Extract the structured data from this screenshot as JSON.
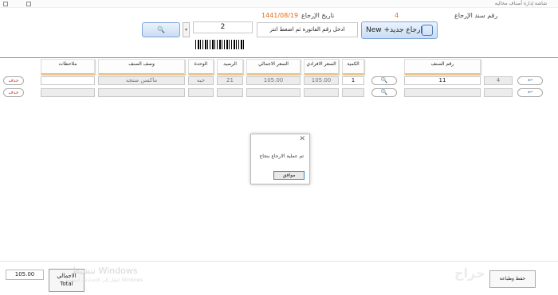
{
  "window": {
    "title": "شاشة إدارة أصناف مخالية"
  },
  "header": {
    "return_no_label": "رقم سند الإرجاع",
    "return_no_value": "4",
    "date_label": "تاريخ الإرجاع",
    "date_value": "1441/08/19"
  },
  "toolbar": {
    "new_button_label": "New +إرجاع جديد",
    "invoice_placeholder": "ادخل رقم الفاتورة ثم اضغط انتر",
    "invoice_number": "2",
    "search_icon": "magnifier-icon"
  },
  "table": {
    "columns": [
      "رقم الصنف",
      "الكمية",
      "السعر الافرادي",
      "السعر الاجمالي",
      "الرصيد",
      "الوحدة",
      "وصف الصنف",
      "ملاحظات"
    ],
    "rows": [
      {
        "index": "4",
        "item_no": "11",
        "qty": "1",
        "unit_price": "105.00",
        "total_price": "105.00",
        "balance": "21",
        "unit": "حبه",
        "description": "ماكسن منتجه",
        "notes": "",
        "delete_label": "حذف"
      },
      {
        "index": "",
        "item_no": "",
        "qty": "",
        "unit_price": "",
        "total_price": "",
        "balance": "",
        "unit": "",
        "description": "",
        "notes": "",
        "delete_label": "حذف"
      }
    ]
  },
  "dialog": {
    "message": "تم عملية الارجاع بنجاح",
    "ok_label": "موافق",
    "close_icon": "close-icon"
  },
  "footer": {
    "total_value": "105.00",
    "total_label_ar": "الاجمالي",
    "total_label_en": "Total",
    "print_button_label": "حفظ وطباعة",
    "watermark": "تنشيط Windows",
    "watermark_sub": "انتقل إلى الإعدادات لتنشيط Windows"
  }
}
